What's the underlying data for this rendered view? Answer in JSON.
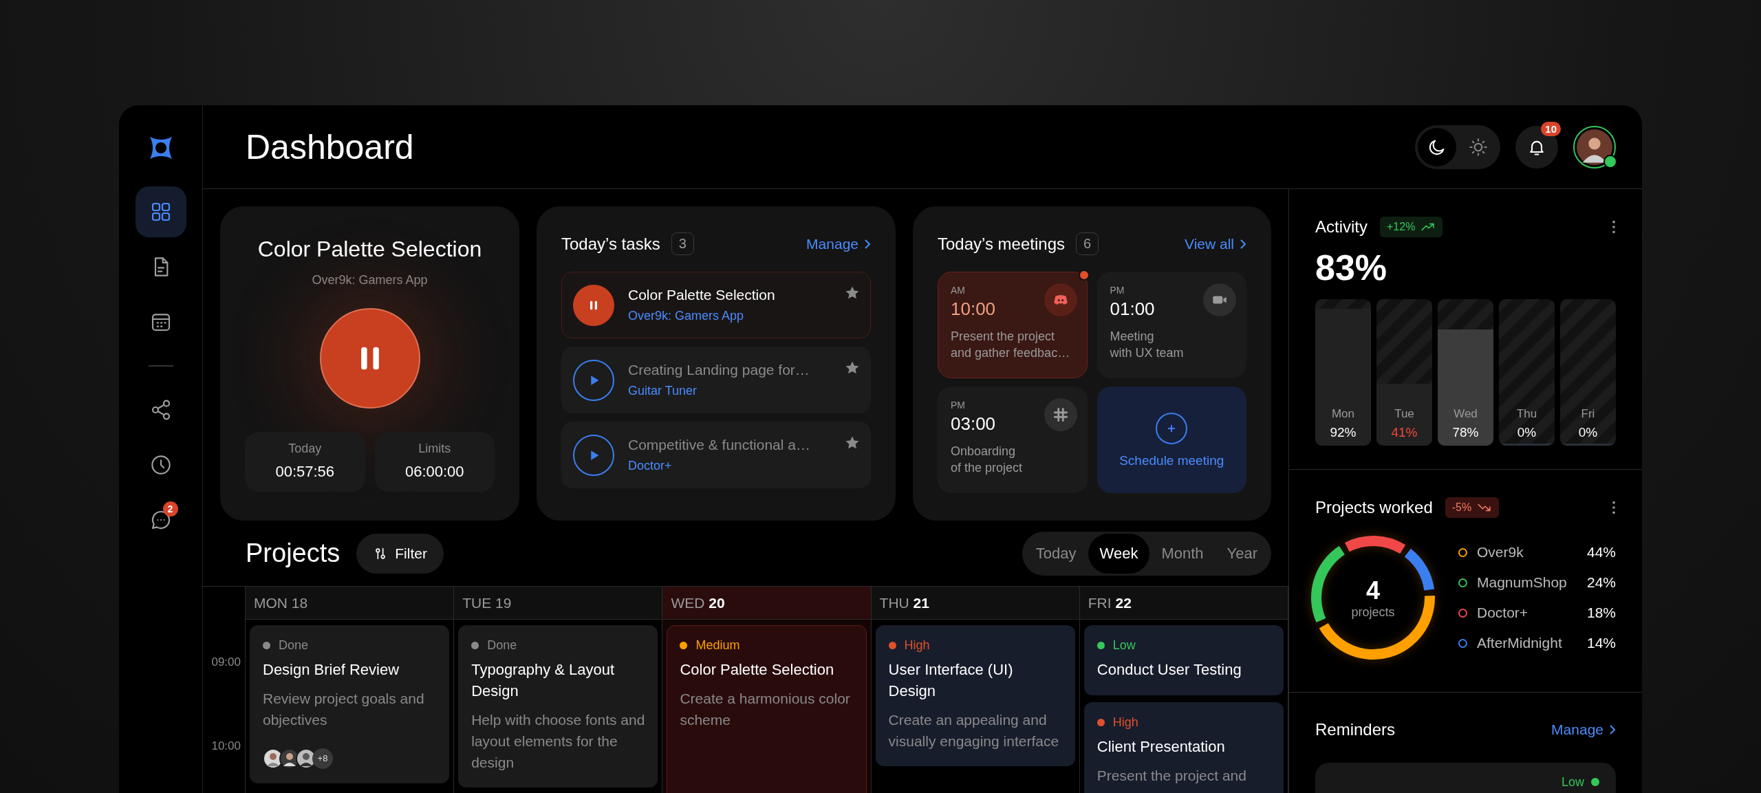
{
  "sidebar": {
    "items": [
      {
        "selected": true
      },
      {
        "selected": false
      },
      {
        "selected": false
      },
      {
        "selected": false
      },
      {
        "selected": false
      },
      {
        "selected": false,
        "badge": "2"
      }
    ]
  },
  "header": {
    "title": "Dashboard",
    "theme_options": [
      {
        "selected": true
      },
      {
        "selected": false
      }
    ],
    "notifications": {
      "badge": "10"
    },
    "user": {
      "online": true
    }
  },
  "timer": {
    "title": "Color Palette Selection",
    "project": "Over9k: Gamers App",
    "running": true,
    "stats": [
      {
        "label": "Today",
        "value": "00:57:56"
      },
      {
        "label": "Limits",
        "value": "06:00:00"
      }
    ]
  },
  "tasks": {
    "title": "Today’s tasks",
    "count": "3",
    "link": "Manage",
    "items": [
      {
        "title": "Color Palette Selection",
        "project": "Over9k: Gamers App",
        "selected": true
      },
      {
        "title": "Creating Landing page for…",
        "project": "Guitar Tuner",
        "selected": false
      },
      {
        "title": "Competitive & functional a…",
        "project": "Doctor+",
        "selected": false
      }
    ]
  },
  "meetings": {
    "title": "Today’s meetings",
    "count": "6",
    "link": "View all",
    "items": [
      {
        "period": "AM",
        "time": "10:00",
        "description": "Present the project\nand gather feedbac…",
        "selected": true
      },
      {
        "period": "PM",
        "time": "01:00",
        "description": "Meeting\nwith UX team",
        "selected": false
      },
      {
        "period": "PM",
        "time": "03:00",
        "description": "Onboarding\nof the project",
        "selected": false
      }
    ],
    "schedule": "Schedule meeting"
  },
  "projects": {
    "title": "Projects",
    "filter": "Filter",
    "ranges": [
      {
        "label": "Today",
        "selected": false
      },
      {
        "label": "Week",
        "selected": true
      },
      {
        "label": "Month",
        "selected": false
      },
      {
        "label": "Year",
        "selected": false
      }
    ]
  },
  "calendar": {
    "times": [
      "09:00",
      "10:00"
    ],
    "days": [
      {
        "weekday": "MON",
        "date": "18",
        "past": true,
        "today": false,
        "events": [
          {
            "status": "Done",
            "color": "#8a8a8a",
            "title": "Design Brief Review",
            "description": "Review project goals and objectives",
            "attendees": [
              {
                "kind": "avatar"
              },
              {
                "kind": "avatar"
              },
              {
                "kind": "avatar"
              }
            ],
            "more_attendees": "+8"
          }
        ]
      },
      {
        "weekday": "TUE",
        "date": "19",
        "past": true,
        "today": false,
        "events": [
          {
            "status": "Done",
            "color": "#8a8a8a",
            "title": "Typography & Layout Design",
            "description": "Help with choose fonts and layout elements for the design"
          }
        ]
      },
      {
        "weekday": "WED",
        "date": "20",
        "past": false,
        "today": true,
        "events": [
          {
            "status": "Medium",
            "color": "#ffa000",
            "title": "Color Palette Selection",
            "description": "Create a harmonious color scheme"
          }
        ]
      },
      {
        "weekday": "THU",
        "date": "21",
        "past": false,
        "today": false,
        "events": [
          {
            "status": "High",
            "color": "#e0502a",
            "title": "User Interface (UI) Design",
            "description": "Create an appealing and visually engaging interface"
          }
        ]
      },
      {
        "weekday": "FRI",
        "date": "22",
        "past": false,
        "today": false,
        "events": [
          {
            "status": "Low",
            "color": "#34c759",
            "title": "Conduct User Testing"
          },
          {
            "status": "High",
            "color": "#e0502a",
            "title": "Client Presentation",
            "description": "Present the project and"
          }
        ]
      }
    ]
  },
  "activity": {
    "title": "Activity",
    "trend": {
      "label": "+12%",
      "kind": "up"
    },
    "total": "83%",
    "days": [
      {
        "label": "Mon",
        "reading": "92%",
        "level": 0.92,
        "selected": false,
        "alert": false
      },
      {
        "label": "Tue",
        "reading": "41%",
        "level": 0.41,
        "selected": false,
        "alert": true
      },
      {
        "label": "Wed",
        "reading": "78%",
        "level": 0.78,
        "selected": true,
        "alert": false
      },
      {
        "label": "Thu",
        "reading": "0%",
        "level": 0,
        "selected": false,
        "alert": false
      },
      {
        "label": "Fri",
        "reading": "0%",
        "level": 0,
        "selected": false,
        "alert": false
      }
    ]
  },
  "projects_worked": {
    "title": "Projects worked",
    "trend": {
      "label": "-5%",
      "kind": "down"
    },
    "total": "4",
    "total_label": "projects",
    "legend": [
      {
        "name": "Over9k",
        "share": "44%",
        "color": "#ffa000"
      },
      {
        "name": "MagnumShop",
        "share": "24%",
        "color": "#34c759"
      },
      {
        "name": "Doctor+",
        "share": "18%",
        "color": "#f04848"
      },
      {
        "name": "AfterMidnight",
        "share": "14%",
        "color": "#3b7ef0"
      }
    ],
    "chart_data": {
      "type": "donut",
      "values": [
        44,
        24,
        18,
        14
      ]
    }
  },
  "reminders": {
    "title": "Reminders",
    "link": "Manage",
    "items": [
      {
        "priority": "Low"
      }
    ]
  }
}
